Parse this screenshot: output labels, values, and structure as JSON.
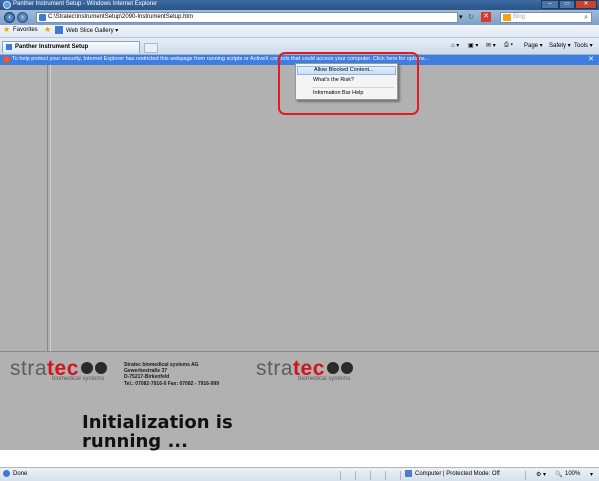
{
  "window": {
    "title": "Panther Instrument Setup - Windows Internet Explorer",
    "min_label": "–",
    "max_label": "▭",
    "close_label": "✕"
  },
  "navigation": {
    "back_icon": "back-arrow-icon",
    "forward_icon": "forward-arrow-icon",
    "address": "C:\\Stratec\\InstrumentSetup\\2090-InstrumentSetup.htm",
    "search_placeholder": "Bing",
    "search_icon": "magnifier-icon"
  },
  "favorites_bar": {
    "favorites_label": "Favorites",
    "web_slice_label": "Web Slice Gallery ▾"
  },
  "tabs": [
    {
      "label": "Panther Instrument Setup"
    }
  ],
  "command_bar": {
    "page_label": "Page ▾",
    "safety_label": "Safety ▾",
    "tools_label": "Tools ▾"
  },
  "info_bar": {
    "message": "To help protect your security, Internet Explorer has restricted this webpage from running scripts or ActiveX controls that could access your computer. Click here for options..."
  },
  "context_menu": {
    "items": [
      {
        "label": "Allow Blocked Content..."
      },
      {
        "label": "What's the Risk?"
      },
      {
        "label": "Information Bar Help"
      }
    ]
  },
  "page": {
    "logo_left": {
      "part1": "stra",
      "part2": "tec",
      "sub": "biomedical systems"
    },
    "company_address": [
      "Stratec biomedical systems AG",
      "Gewerbestraße 37",
      "D-75217-Birkenfeld",
      "Tel.: 07082-7916-0 Fax: 07082 - 7916-999"
    ],
    "logo_right": {
      "part1": "stra",
      "part2": "tec",
      "sub": "biomedical systems"
    },
    "status_message_line1": "Initialization is",
    "status_message_line2": "running ..."
  },
  "status_bar": {
    "left_text": "Done",
    "zone_text": "Computer | Protected Mode: Off",
    "zoom_text": "100%"
  },
  "colors": {
    "accent": "#3d7ee0",
    "highlight_border": "#e01e1e",
    "logo_red": "#d2141b",
    "content_bg": "#b1b1b1"
  }
}
